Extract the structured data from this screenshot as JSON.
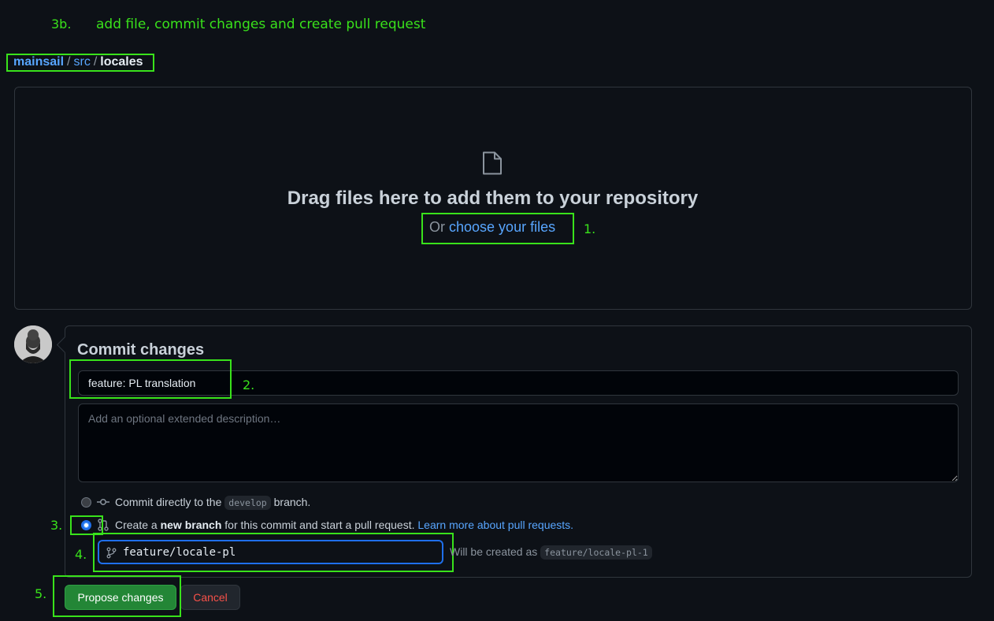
{
  "caption": {
    "step": "3b.",
    "title": "add file, commit changes and create pull request"
  },
  "breadcrumb": {
    "repo": "mainsail",
    "dir": "src",
    "current": "locales",
    "separator": "/"
  },
  "dropzone": {
    "icon": "file-icon",
    "title": "Drag files here to add them to your repository",
    "prefix": "Or",
    "link": "choose your files"
  },
  "commit": {
    "heading": "Commit changes",
    "summary_value": "feature: PL translation",
    "description_placeholder": "Add an optional extended description…",
    "option_direct": {
      "prefix": "Commit directly to the",
      "branch": "develop",
      "suffix": "branch.",
      "selected": false
    },
    "option_new_branch": {
      "prefix": "Create a",
      "bold": "new branch",
      "suffix": "for this commit and start a pull request.",
      "link": "Learn more about pull requests.",
      "selected": true
    },
    "branch_value": "feature/locale-pl",
    "branch_note_prefix": "Will be created as",
    "branch_note_value": "feature/locale-pl-1"
  },
  "buttons": {
    "propose": "Propose changes",
    "cancel": "Cancel"
  },
  "annotations": {
    "a1": "1.",
    "a2": "2.",
    "a3": "3.",
    "a4": "4.",
    "a5": "5."
  },
  "colors": {
    "background": "#0d1117",
    "accent_link": "#58a6ff",
    "annotation_green": "#39e21b",
    "primary_button": "#238636",
    "danger_text": "#f85149"
  }
}
